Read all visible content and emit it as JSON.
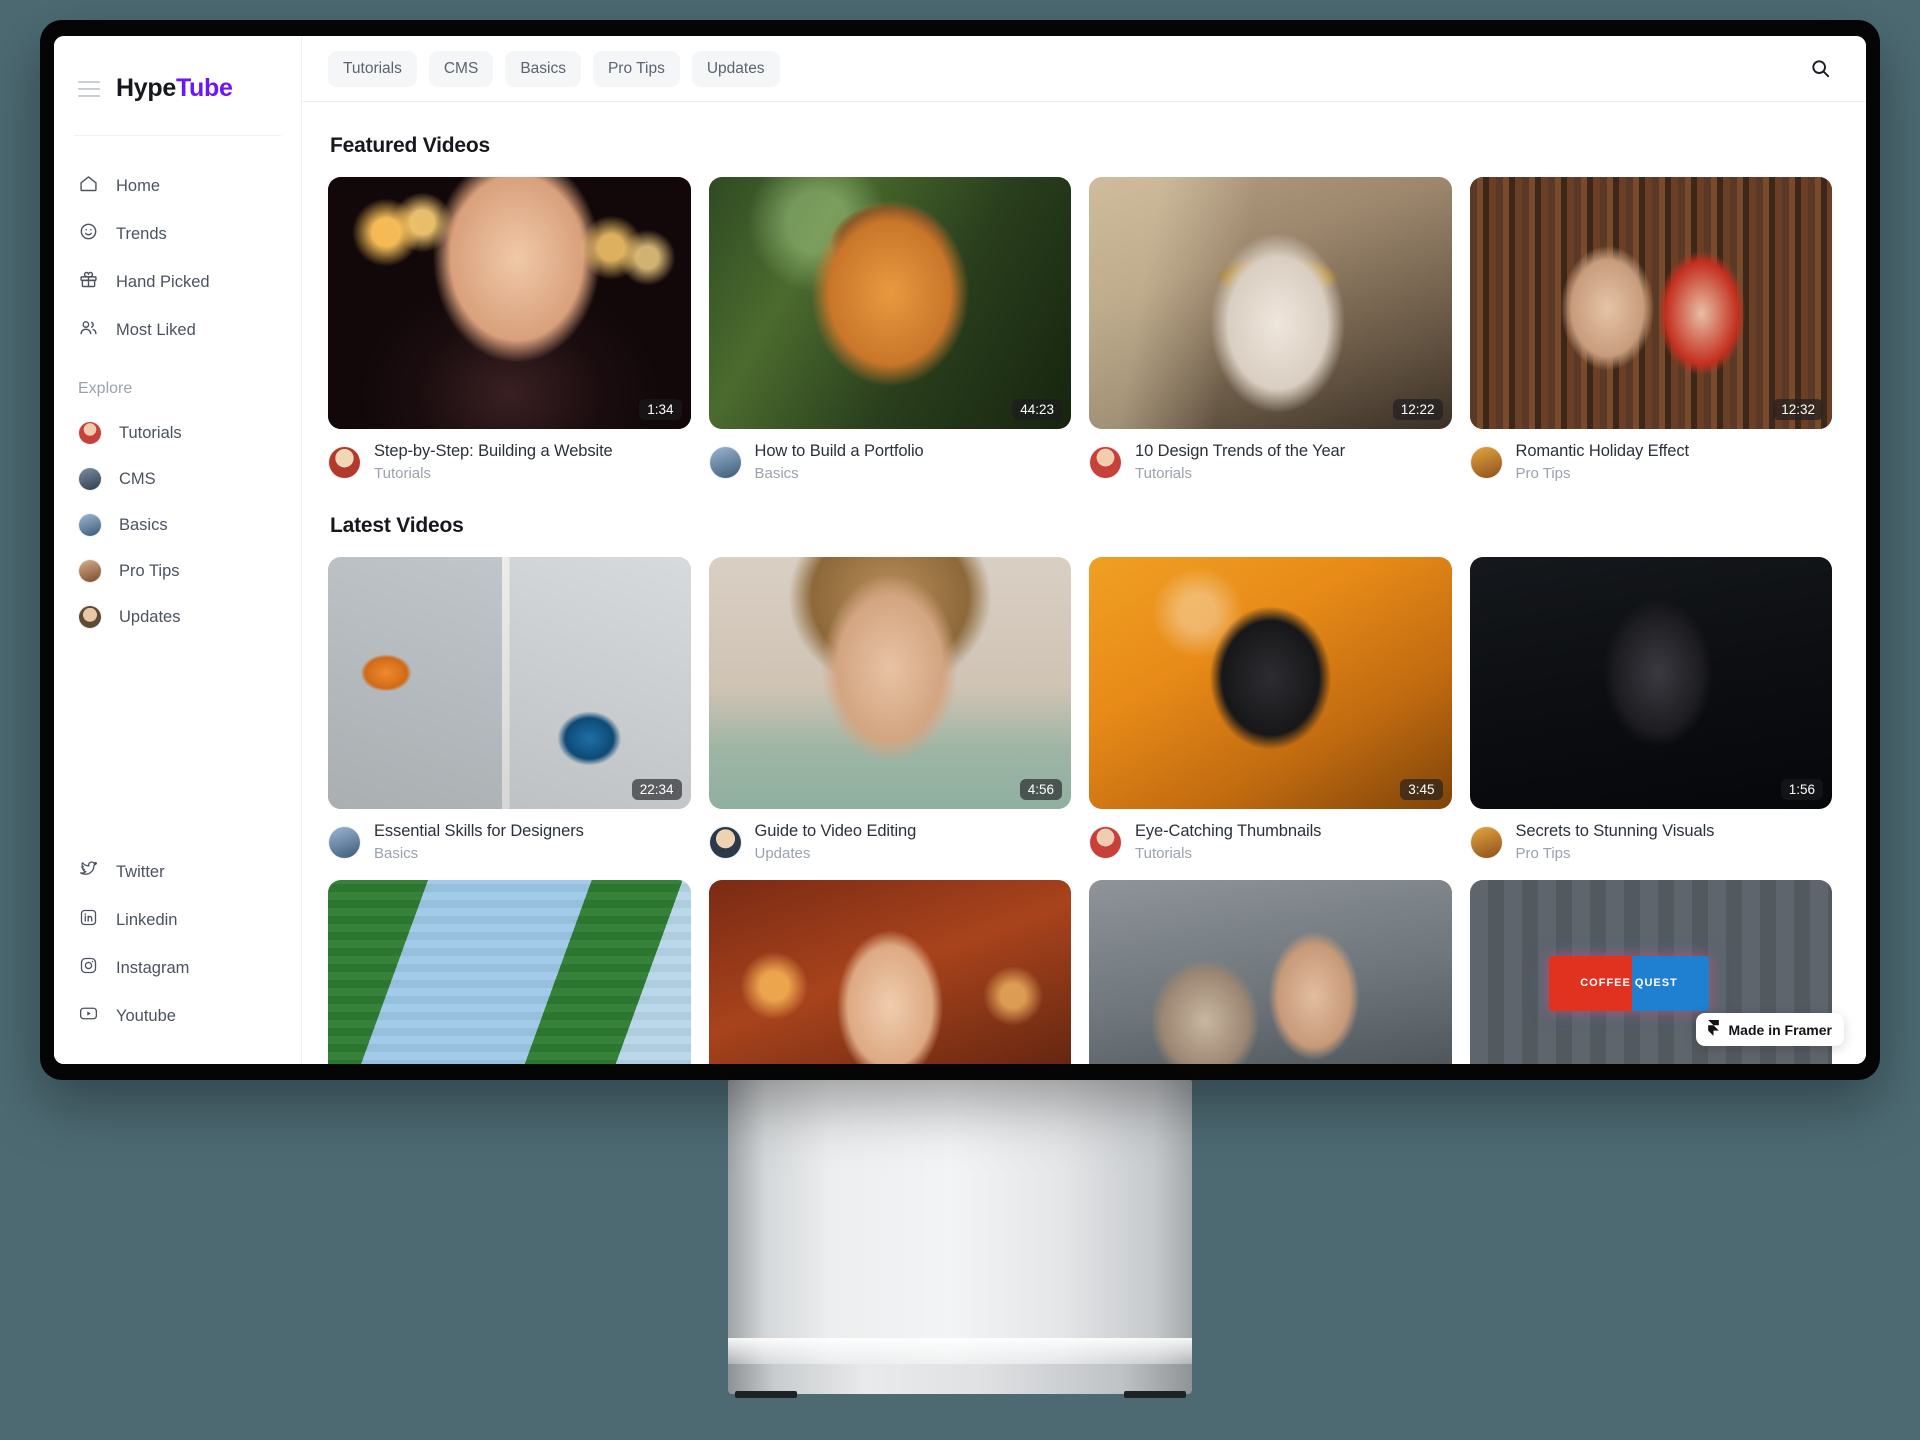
{
  "brand": {
    "name_first": "Hype",
    "name_accent": "Tube"
  },
  "sidebar": {
    "nav": [
      {
        "label": "Home",
        "icon": "home-icon"
      },
      {
        "label": "Trends",
        "icon": "smiley-icon"
      },
      {
        "label": "Hand Picked",
        "icon": "gift-icon"
      },
      {
        "label": "Most Liked",
        "icon": "people-icon"
      }
    ],
    "explore_label": "Explore",
    "explore": [
      {
        "label": "Tutorials",
        "avatar": "av-a"
      },
      {
        "label": "CMS",
        "avatar": "av-b"
      },
      {
        "label": "Basics",
        "avatar": "av-c"
      },
      {
        "label": "Pro Tips",
        "avatar": "av-e"
      },
      {
        "label": "Updates",
        "avatar": "av-d"
      }
    ],
    "social": [
      {
        "label": "Twitter",
        "icon": "twitter-icon"
      },
      {
        "label": "Linkedin",
        "icon": "linkedin-icon"
      },
      {
        "label": "Instagram",
        "icon": "instagram-icon"
      },
      {
        "label": "Youtube",
        "icon": "youtube-icon"
      }
    ]
  },
  "topbar": {
    "pills": [
      "Tutorials",
      "CMS",
      "Basics",
      "Pro Tips",
      "Updates"
    ],
    "search_icon": "search-icon"
  },
  "sections": {
    "featured_title": "Featured Videos",
    "latest_title": "Latest Videos"
  },
  "featured": [
    {
      "title": "Step-by-Step: Building a Website",
      "category": "Tutorials",
      "duration": "1:34",
      "art": "art-latex",
      "avatar": "av-f"
    },
    {
      "title": "How to Build a Portfolio",
      "category": "Basics",
      "duration": "44:23",
      "art": "art-jungle",
      "avatar": "av-c"
    },
    {
      "title": "10 Design Trends of the Year",
      "category": "Tutorials",
      "duration": "12:22",
      "art": "art-egypt",
      "avatar": "av-a"
    },
    {
      "title": "Romantic Holiday Effect",
      "category": "Pro Tips",
      "duration": "12:32",
      "art": "art-library",
      "avatar": "av-g"
    }
  ],
  "latest": [
    {
      "title": "Essential Skills for Designers",
      "category": "Basics",
      "duration": "22:34",
      "art": "art-cars",
      "avatar": "av-c"
    },
    {
      "title": "Guide to Video Editing",
      "category": "Updates",
      "duration": "4:56",
      "art": "art-portrait",
      "avatar": "av-h"
    },
    {
      "title": "Eye-Catching Thumbnails",
      "category": "Tutorials",
      "duration": "3:45",
      "art": "art-gasmask",
      "avatar": "av-a"
    },
    {
      "title": "Secrets to Stunning Visuals",
      "category": "Pro Tips",
      "duration": "1:56",
      "art": "art-dark",
      "avatar": "av-g"
    }
  ],
  "next_row": [
    {
      "art": "art-lego"
    },
    {
      "art": "art-lips"
    },
    {
      "art": "art-wolf"
    },
    {
      "art": "art-neon",
      "sign_text": "COFFEE QUEST"
    }
  ],
  "badge": {
    "text": "Made in Framer",
    "icon": "framer-logo-icon"
  },
  "colors": {
    "accent": "#6f15f5",
    "background": "#4d6a73",
    "pill_bg": "#f5f6f8"
  }
}
